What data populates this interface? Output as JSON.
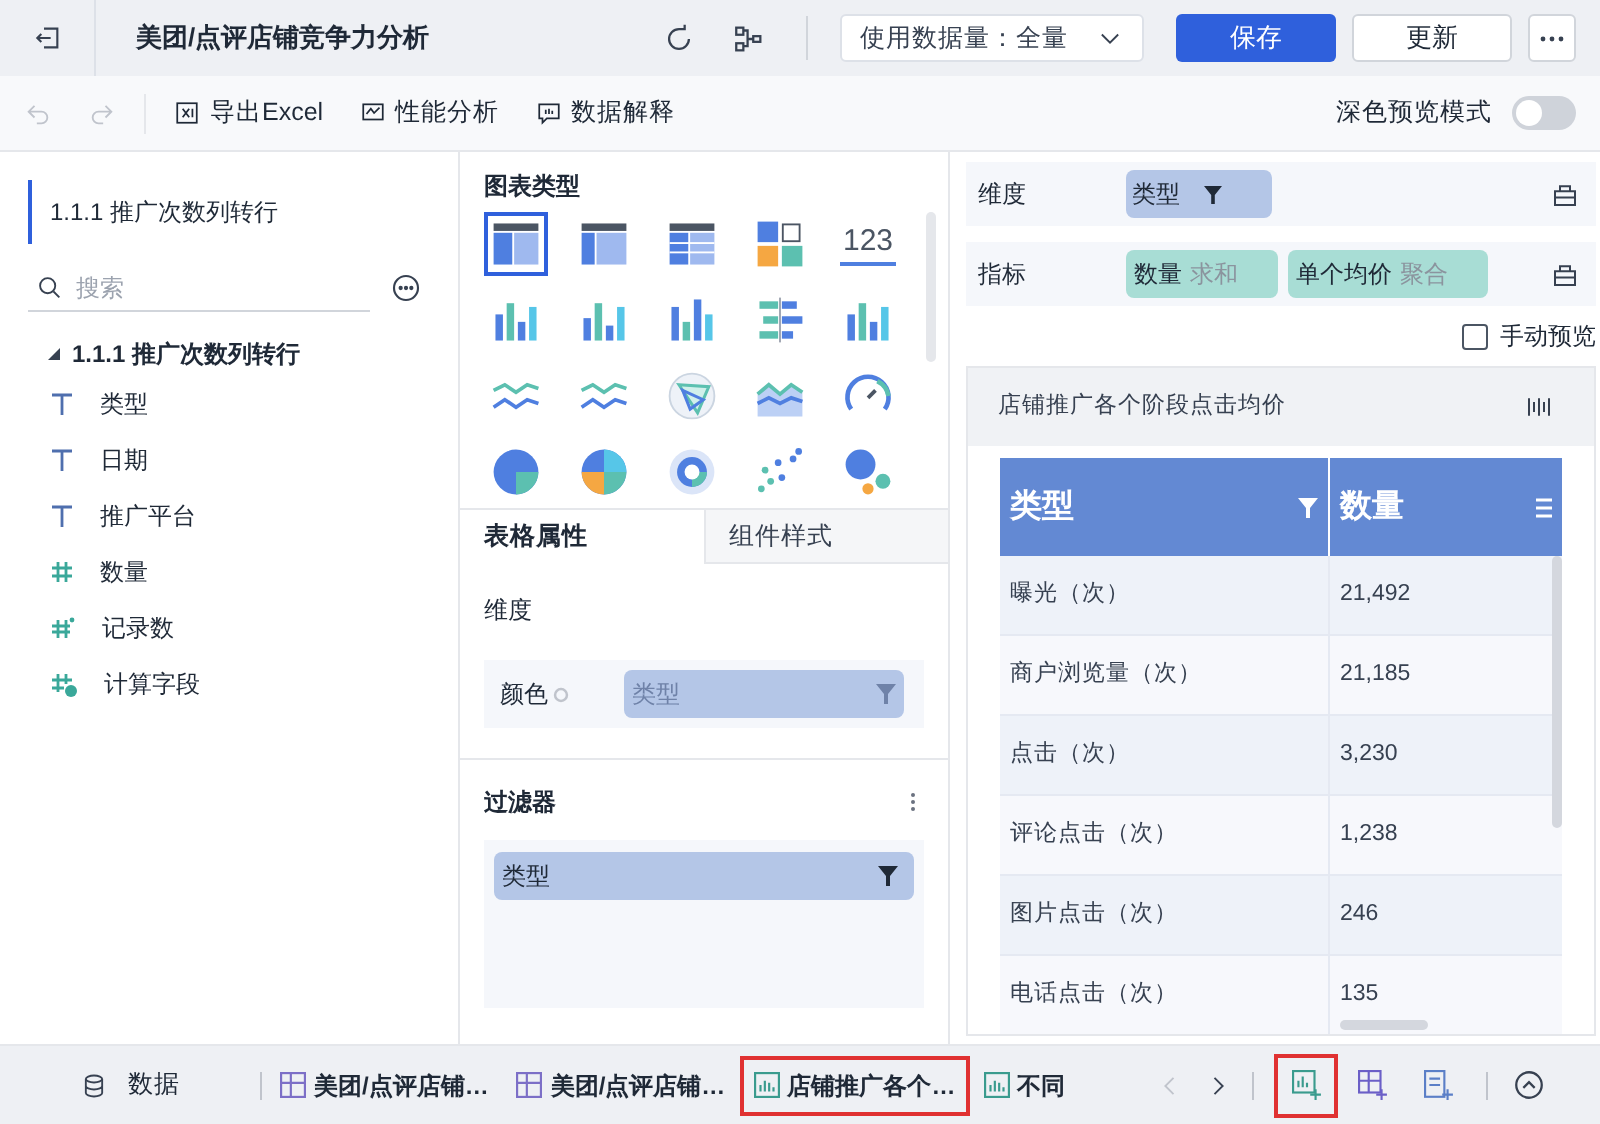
{
  "header": {
    "title": "美团/点评店铺竞争力分析",
    "data_volume": "使用数据量：全量",
    "save": "保存",
    "update": "更新"
  },
  "toolbar": {
    "items": [
      {
        "kind": "excel",
        "label": "导出Excel"
      },
      {
        "kind": "perf",
        "label": "性能分析"
      },
      {
        "kind": "explain",
        "label": "数据解释"
      }
    ],
    "dark_mode": {
      "label": "深色预览模式",
      "on": false
    }
  },
  "data_panel": {
    "dataset": "1.1.1 推广次数列转行",
    "search": {
      "placeholder": "搜索"
    },
    "tree": {
      "label": "1.1.1 推广次数列转行",
      "expanded": true,
      "children": [
        {
          "kind": "text",
          "label": "类型"
        },
        {
          "kind": "text",
          "label": "日期"
        },
        {
          "kind": "text",
          "label": "推广平台"
        },
        {
          "kind": "number",
          "label": "数量"
        },
        {
          "kind": "count",
          "label": "记录数"
        },
        {
          "kind": "calc",
          "label": "计算字段"
        }
      ]
    }
  },
  "chart_types": {
    "title": "图表类型",
    "items": [
      {
        "kind": "table",
        "selected": true
      },
      {
        "kind": "pivot",
        "selected": false
      },
      {
        "kind": "detail",
        "selected": false
      },
      {
        "kind": "cards",
        "selected": false
      },
      {
        "kind": "number",
        "label": "123",
        "selected": false
      },
      {
        "kind": "bar",
        "selected": false
      },
      {
        "kind": "bar",
        "selected": false
      },
      {
        "kind": "bar",
        "selected": false
      },
      {
        "kind": "hbar",
        "selected": false
      },
      {
        "kind": "bar",
        "selected": false
      },
      {
        "kind": "line",
        "selected": false
      },
      {
        "kind": "line",
        "selected": false
      },
      {
        "kind": "radar",
        "selected": false
      },
      {
        "kind": "area",
        "selected": false
      },
      {
        "kind": "gauge",
        "selected": false
      },
      {
        "kind": "pie",
        "selected": false
      },
      {
        "kind": "pie",
        "selected": false
      },
      {
        "kind": "donut",
        "selected": false
      },
      {
        "kind": "scatter",
        "selected": false
      },
      {
        "kind": "bubble",
        "selected": false
      }
    ]
  },
  "property_tabs": [
    {
      "label": "表格属性",
      "selected": true
    },
    {
      "label": "组件样式",
      "selected": false
    }
  ],
  "properties": {
    "section": "维度",
    "rows": [
      {
        "label": "颜色",
        "field": "类型",
        "disabled": true
      }
    ]
  },
  "filter": {
    "title": "过滤器",
    "fields": [
      "类型"
    ]
  },
  "bindings": [
    {
      "label": "维度",
      "pills": [
        {
          "kind": "dimension",
          "name": "类型"
        }
      ]
    },
    {
      "label": "指标",
      "pills": [
        {
          "kind": "measure",
          "name": "数量",
          "agg": "求和"
        },
        {
          "kind": "measure",
          "name": "单个均价",
          "agg": "聚合"
        }
      ]
    }
  ],
  "manual_preview": {
    "label": "手动预览",
    "checked": false
  },
  "preview": {
    "title": "店铺推广各个阶段点击均价",
    "table": {
      "columns": [
        "类型",
        "数量"
      ],
      "rows": [
        [
          "曝光（次）",
          "21,492"
        ],
        [
          "商户浏览量（次）",
          "21,185"
        ],
        [
          "点击（次）",
          "3,230"
        ],
        [
          "评论点击（次）",
          "1,238"
        ],
        [
          "图片点击（次）",
          "246"
        ],
        [
          "电话点击（次）",
          "135"
        ]
      ]
    }
  },
  "bottom_bar": {
    "data": "数据",
    "tabs": [
      {
        "kind": "dashboard",
        "label": "美团/点评店铺…",
        "selected": false
      },
      {
        "kind": "dashboard",
        "label": "美团/点评店铺…",
        "selected": false
      },
      {
        "kind": "chart",
        "label": "店铺推广各个…",
        "selected": true
      },
      {
        "kind": "chart",
        "label": "不同",
        "selected": false
      }
    ]
  }
}
